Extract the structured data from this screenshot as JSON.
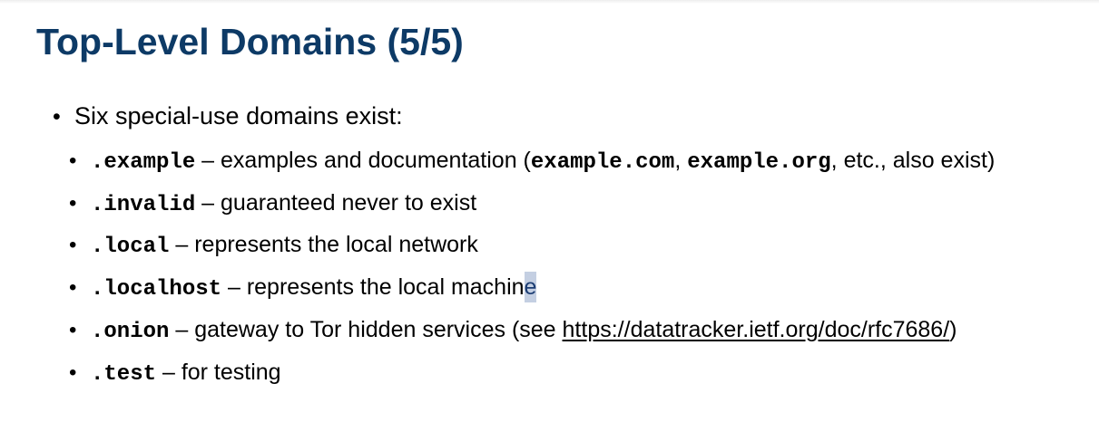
{
  "slide": {
    "title": "Top-Level Domains (5/5)",
    "intro": "Six special-use domains exist:",
    "bullet_glyph": "•",
    "items": [
      {
        "domain": ".example",
        "dash": " – ",
        "text_before": "examples and documentation (",
        "code1": "example.com",
        "sep": ", ",
        "code2": "example.org",
        "text_after": ", etc., also exist)"
      },
      {
        "domain": ".invalid",
        "dash": " – ",
        "text": "guaranteed never to exist"
      },
      {
        "domain": ".local",
        "dash": " – ",
        "text": "represents the local network"
      },
      {
        "domain": ".localhost",
        "dash": " – ",
        "text": "represents the local machin",
        "text_highlighted": "e"
      },
      {
        "domain": ".onion",
        "dash": " – ",
        "text_before": "gateway to Tor hidden services (see ",
        "link": "https://datatracker.ietf.org/doc/rfc7686/",
        "text_after": ")"
      },
      {
        "domain": ".test",
        "dash": " – ",
        "text": "for testing"
      }
    ]
  },
  "colors": {
    "title": "#0d3a66",
    "text": "#000000",
    "selection_highlight": "#c4cfe2"
  }
}
